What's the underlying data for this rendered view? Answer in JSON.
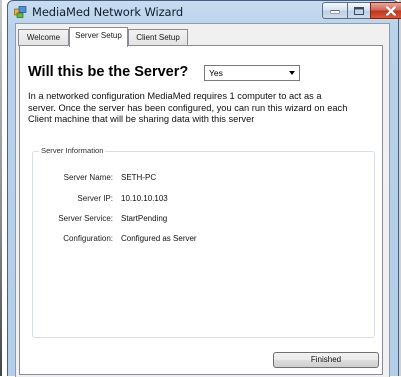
{
  "window": {
    "title": "MediaMed Network Wizard"
  },
  "tabs": [
    {
      "label": "Welcome"
    },
    {
      "label": "Server Setup",
      "active": true
    },
    {
      "label": "Client Setup"
    }
  ],
  "server_setup": {
    "question": "Will this be the Server?",
    "server_choice": "Yes",
    "description_lines": [
      "In a networked configuration MediaMed requires 1 computer to act as a",
      "server. Once the server has been configured, you can run this wizard on each",
      "Client machine that will be sharing data with this server"
    ],
    "group_title": "Server Information",
    "fields": [
      {
        "label": "Server Name:",
        "value": "SETH-PC"
      },
      {
        "label": "Server IP:",
        "value": "10.10.10.103"
      },
      {
        "label": "Server Service:",
        "value": "StartPending"
      },
      {
        "label": "Configuration:",
        "value": "Configured as Server"
      }
    ],
    "finish_label": "Finished"
  },
  "colors": {
    "titlebar": "#b9d1ea",
    "close_button": "#c2351f"
  }
}
